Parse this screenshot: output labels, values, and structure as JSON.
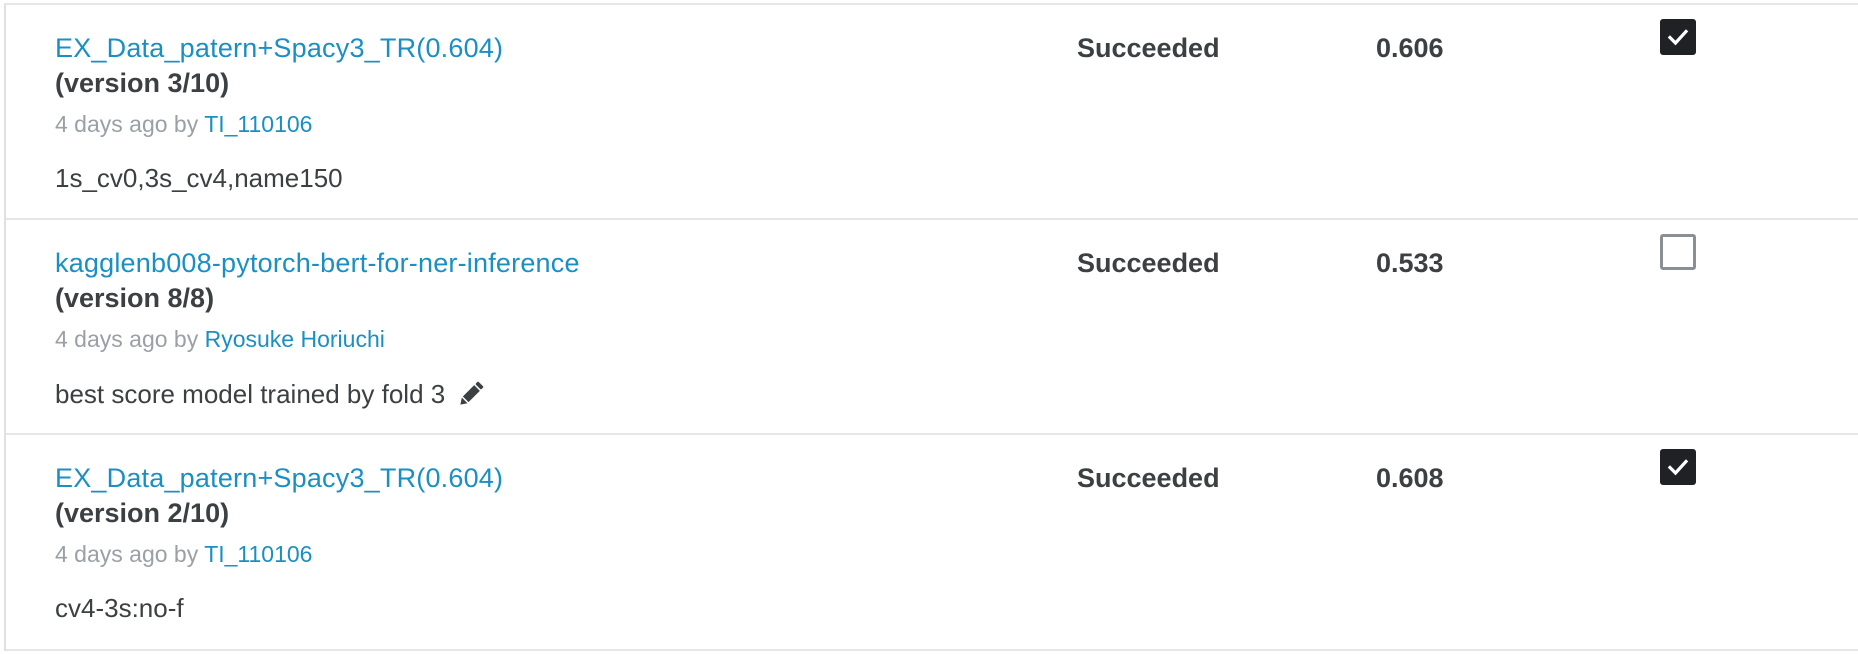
{
  "submissions": [
    {
      "title": "EX_Data_patern+Spacy3_TR(0.604)",
      "version": "(version 3/10)",
      "time": "4 days ago by ",
      "author": "TI_110106",
      "description": "1s_cv0,3s_cv4,name150",
      "status": "Succeeded",
      "score": "0.606",
      "selected": true,
      "has_edit_icon": false
    },
    {
      "title": "kagglenb008-pytorch-bert-for-ner-inference",
      "version": "(version 8/8)",
      "time": "4 days ago by ",
      "author": "Ryosuke Horiuchi",
      "description": "best score model trained by fold 3",
      "status": "Succeeded",
      "score": "0.533",
      "selected": false,
      "has_edit_icon": true
    },
    {
      "title": "EX_Data_patern+Spacy3_TR(0.604)",
      "version": "(version 2/10)",
      "time": "4 days ago by ",
      "author": "TI_110106",
      "description": "cv4-3s:no-f",
      "status": "Succeeded",
      "score": "0.608",
      "selected": true,
      "has_edit_icon": false
    }
  ],
  "icons": {
    "edit": "pencil-icon",
    "check": "checkmark-icon"
  },
  "colors": {
    "link": "#1a8fc4",
    "text": "#3c4043",
    "muted": "#9aa0a6",
    "checkbox_checked": "#202124",
    "checkbox_border": "#8a8f94",
    "divider": "#e6e6e6"
  }
}
